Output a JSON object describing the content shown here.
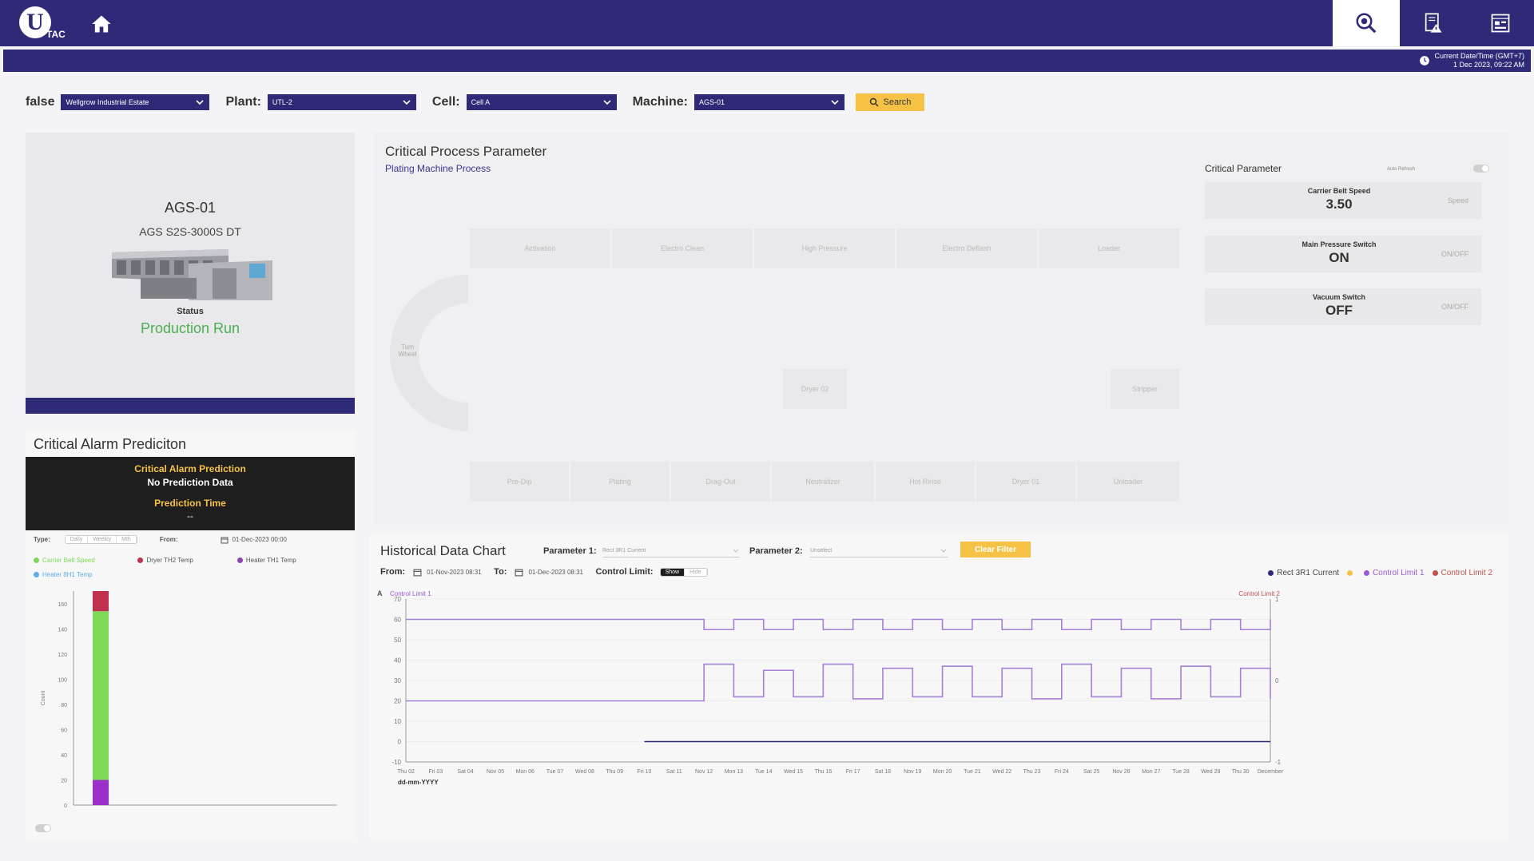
{
  "header": {
    "logo_text": "U",
    "logo_sub": "TAC"
  },
  "clock": {
    "label": "Current Date/Time (GMT+7)",
    "value": "1 Dec 2023, 09:22 AM"
  },
  "filters": {
    "estate_label": "false",
    "estate_value": "Wellgrow Industrial Estate",
    "plant_label": "Plant:",
    "plant_value": "UTL-2",
    "cell_label": "Cell:",
    "cell_value": "Cell A",
    "machine_label": "Machine:",
    "machine_value": "AGS-01",
    "search_label": "Search"
  },
  "machine": {
    "name": "AGS-01",
    "model": "AGS S2S-3000S DT",
    "status_label": "Status",
    "status": "Production Run"
  },
  "alarm": {
    "title": "Critical Alarm Prediciton",
    "box_title": "Critical Alarm Prediction",
    "box_value": "No Prediction Data",
    "time_label": "Prediction Time",
    "time_value": "--",
    "type_label": "Type:",
    "type_options": [
      "Daily",
      "Weekly",
      "Mth"
    ],
    "from_label": "From:",
    "from_value": "01-Dec-2023 00:00",
    "legend": [
      {
        "name": "Carrier Belt Speed",
        "color": "#7ed957"
      },
      {
        "name": "Dryer TH2 Temp",
        "color": "#c0304f"
      },
      {
        "name": "Heater TH1 Temp",
        "color": "#8e44ad"
      },
      {
        "name": "Heater 8H1 Temp",
        "color": "#5dade2"
      }
    ],
    "y_axis_label": "Count"
  },
  "cpp": {
    "title": "Critical Process Parameter",
    "subtitle": "Plating Machine Process",
    "top_stages": [
      "Activation",
      "Electro Clean",
      "High Pressure",
      "Electro Deflash",
      "Loader"
    ],
    "mid_stages": [
      "Dryer 02",
      "Stripper"
    ],
    "turn_wheel": "Turn Wheel",
    "bottom_stages": [
      "Pre-Dip",
      "Plating",
      "Drag-Out",
      "Neutralizer",
      "Hot Rinse",
      "Dryer 01",
      "Unloader"
    ],
    "crit_title": "Critical Parameter",
    "auto_refresh": "Auto Refresh",
    "params": [
      {
        "name": "Carrier Belt Speed",
        "value": "3.50",
        "unit": "Speed"
      },
      {
        "name": "Main Pressure Switch",
        "value": "ON",
        "unit": "ON/OFF"
      },
      {
        "name": "Vacuum Switch",
        "value": "OFF",
        "unit": "ON/OFF"
      }
    ]
  },
  "hist": {
    "title": "Historical Data Chart",
    "param1_label": "Parameter 1:",
    "param1_value": "Rect 3R1 Current",
    "param2_label": "Parameter 2:",
    "param2_value": "Unselect",
    "clear_label": "Clear Filter",
    "from_label": "From:",
    "from_value": "01-Nov-2023 08:31",
    "to_label": "To:",
    "to_value": "01-Dec-2023 08:31",
    "cl_label": "Control Limit:",
    "cl_show": "Show",
    "cl_hide": "Hide",
    "legend": [
      {
        "name": "Rect 3R1 Current",
        "color": "#2e2a78"
      },
      {
        "name": "",
        "color": "#f5c245"
      },
      {
        "name": "Control Limit 1",
        "color": "#9b59d6"
      },
      {
        "name": "Control Limit 2",
        "color": "#c0504d"
      }
    ],
    "left_axis_note": "A",
    "left_axis_tag": "Control Limit 1",
    "right_axis_tag": "Control Limit 2",
    "x_format": "dd-mm-YYYY"
  },
  "chart_data": [
    {
      "type": "bar",
      "categories": [
        ""
      ],
      "y_ticks": [
        0,
        20,
        40,
        60,
        80,
        100,
        120,
        140,
        160
      ],
      "ylim": [
        0,
        170
      ],
      "ylabel": "Count",
      "series": [
        {
          "name": "Heater TH1 Temp",
          "values": [
            20
          ],
          "color": "#9b30c9"
        },
        {
          "name": "Carrier Belt Speed",
          "values": [
            134
          ],
          "color": "#7ed957"
        },
        {
          "name": "Dryer TH2 Temp",
          "values": [
            16
          ],
          "color": "#c0304f"
        }
      ],
      "stacked": true
    },
    {
      "type": "line",
      "x": [
        "Thu 02",
        "Fri 03",
        "Sat 04",
        "Nov 05",
        "Mon 06",
        "Tue 07",
        "Wed 08",
        "Thu 09",
        "Fri 10",
        "Sat 11",
        "Nov 12",
        "Mon 13",
        "Tue 14",
        "Wed 15",
        "Thu 16",
        "Fri 17",
        "Sat 18",
        "Nov 19",
        "Mon 20",
        "Tue 21",
        "Wed 22",
        "Thu 23",
        "Fri 24",
        "Sat 25",
        "Nov 26",
        "Mon 27",
        "Tue 28",
        "Wed 29",
        "Thu 30",
        "December"
      ],
      "y_ticks": [
        -10,
        0,
        10,
        20,
        30,
        40,
        50,
        60,
        70
      ],
      "ylim": [
        -10,
        70
      ],
      "right_ticks": [
        -1,
        0,
        1
      ],
      "series": [
        {
          "name": "Control Limit 1",
          "color": "#a67fd6",
          "values": [
            20,
            20,
            20,
            20,
            20,
            20,
            20,
            20,
            20,
            20,
            38,
            22,
            35,
            22,
            38,
            21,
            36,
            22,
            37,
            22,
            36,
            21,
            38,
            22,
            36,
            21,
            37,
            22,
            36,
            21
          ]
        },
        {
          "name": "Control Limit 1 upper",
          "color": "#a67fd6",
          "values": [
            60,
            60,
            60,
            60,
            60,
            60,
            60,
            60,
            60,
            60,
            55,
            60,
            55,
            60,
            55,
            60,
            55,
            60,
            55,
            60,
            55,
            60,
            55,
            60,
            55,
            60,
            55,
            60,
            55,
            60
          ]
        },
        {
          "name": "Rect 3R1 Current",
          "color": "#2e2a78",
          "values": [
            null,
            null,
            null,
            null,
            null,
            null,
            null,
            null,
            0,
            0,
            0,
            0,
            0,
            0,
            0,
            0,
            0,
            0,
            0,
            0,
            0,
            0,
            0,
            0,
            0,
            0,
            0,
            0,
            0,
            0
          ]
        }
      ]
    }
  ]
}
